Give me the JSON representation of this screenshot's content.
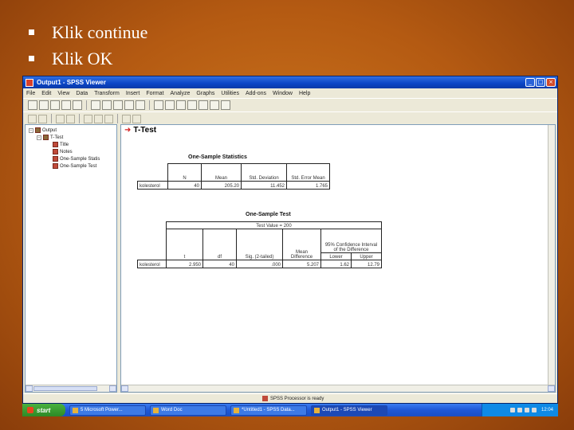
{
  "slide": {
    "bullets": [
      "Klik continue",
      "Klik OK"
    ]
  },
  "window": {
    "title": "Output1 - SPSS Viewer",
    "controls": {
      "minimize": "_",
      "maximize": "□",
      "close": "×"
    }
  },
  "menu": [
    "File",
    "Edit",
    "View",
    "Data",
    "Transform",
    "Insert",
    "Format",
    "Analyze",
    "Graphs",
    "Utilities",
    "Add-ons",
    "Window",
    "Help"
  ],
  "outline": {
    "items": [
      {
        "label": "Output",
        "level": 0
      },
      {
        "label": "T-Test",
        "level": 1
      },
      {
        "label": "Title",
        "level": 2
      },
      {
        "label": "Notes",
        "level": 2
      },
      {
        "label": "One-Sample Statis",
        "level": 2
      },
      {
        "label": "One-Sample Test",
        "level": 2
      }
    ]
  },
  "output": {
    "heading": "T-Test",
    "stats_table": {
      "caption": "One-Sample Statistics",
      "headers": [
        "N",
        "Mean",
        "Std. Deviation",
        "Std. Error Mean"
      ],
      "row_label": "kolesterol",
      "row": [
        "40",
        "205.20",
        "11.452",
        "1.765"
      ]
    },
    "test_table": {
      "caption": "One-Sample Test",
      "test_value": "Test Value = 200",
      "ci_header": "95% Confidence Interval of the Difference",
      "headers": [
        "t",
        "df",
        "Sig. (2-tailed)",
        "Mean Difference",
        "Lower",
        "Upper"
      ],
      "row_label": "kolesterol",
      "row": [
        "2.950",
        "40",
        ".000",
        "5.207",
        "1.62",
        "12.79"
      ]
    }
  },
  "status": {
    "text": "SPSS Processor is ready"
  },
  "taskbar": {
    "start": "start",
    "buttons": [
      {
        "label": "5 Microsoft Power...",
        "active": false
      },
      {
        "label": "Word Doc",
        "active": false
      },
      {
        "label": "*Untitled1 - SPSS Data...",
        "active": false
      },
      {
        "label": "Output1 - SPSS Viewer",
        "active": true
      }
    ],
    "clock": "12:04"
  }
}
